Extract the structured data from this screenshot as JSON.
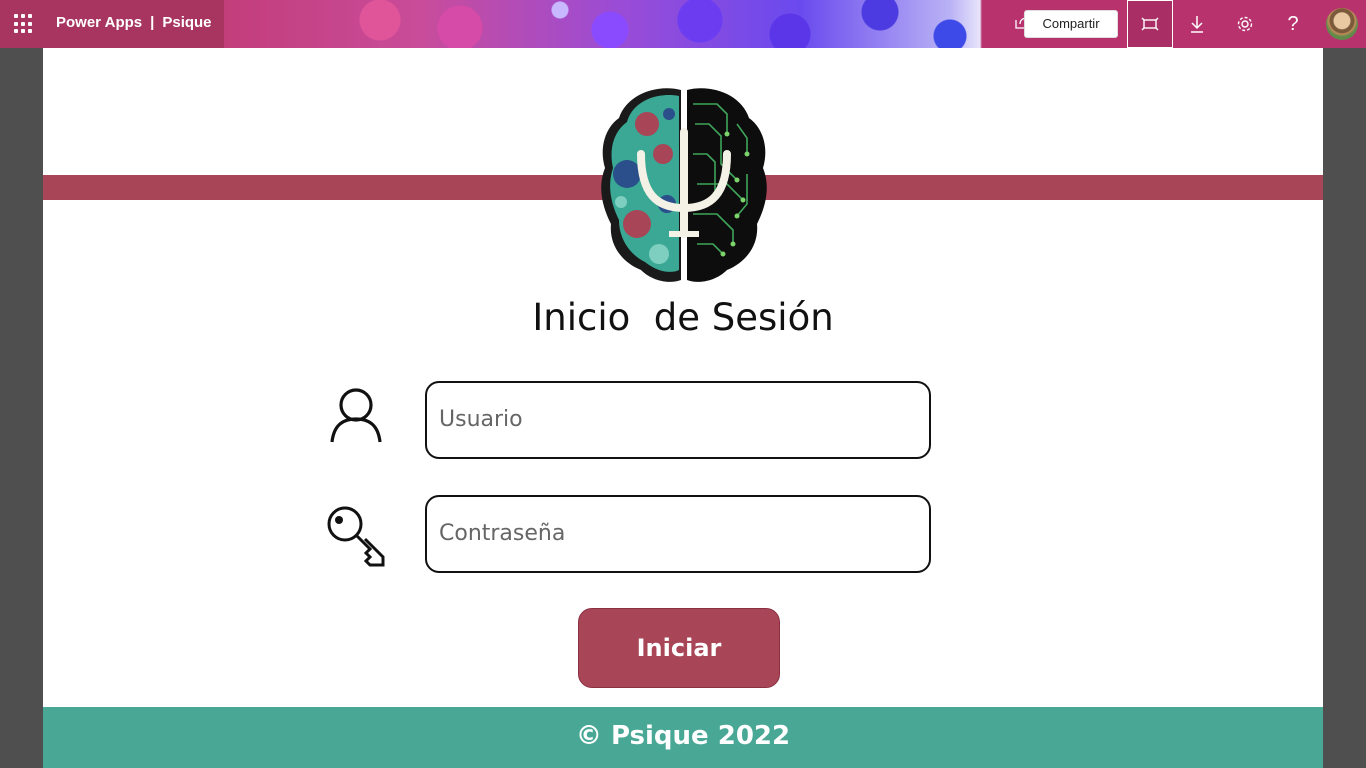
{
  "topbar": {
    "app_name": "Power Apps",
    "separator": "|",
    "app_title": "Psique",
    "share_label": "Compartir",
    "help_label": "?",
    "icons": [
      "waffle-icon",
      "share-icon",
      "fit-to-window-icon",
      "download-icon",
      "settings-icon",
      "help-icon",
      "avatar"
    ]
  },
  "screen": {
    "title": "Inicio  de Sesión",
    "username": {
      "placeholder": "Usuario",
      "value": ""
    },
    "password": {
      "placeholder": "Contraseña",
      "value": ""
    },
    "login_label": "Iniciar",
    "footer": "© Psique 2022"
  },
  "colors": {
    "accent": "#a84557",
    "footer": "#48a795",
    "topbar": "#b8326e",
    "backdrop": "#4f4f4f"
  }
}
